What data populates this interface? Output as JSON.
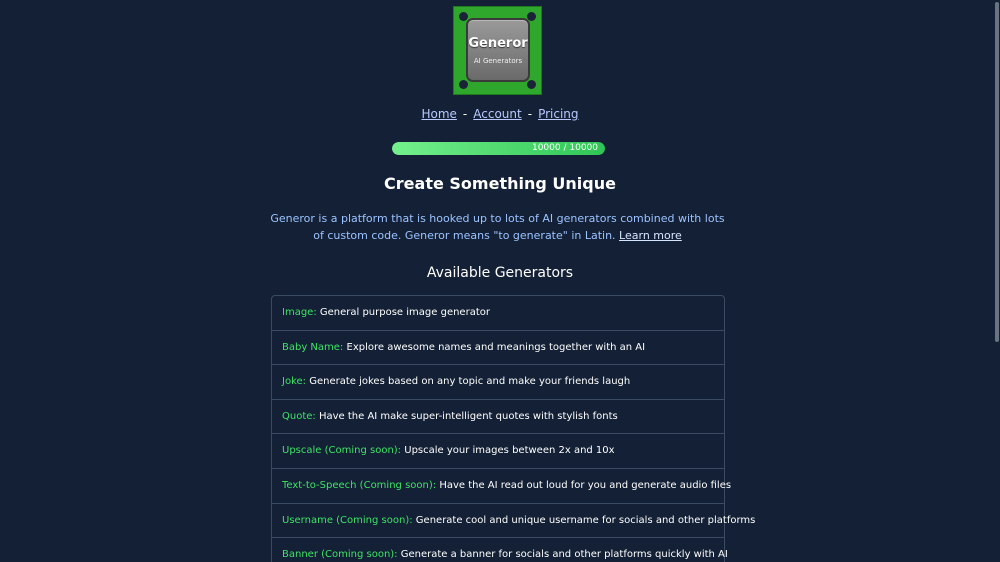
{
  "logo": {
    "title": "Generor",
    "subtitle": "AI Generators"
  },
  "nav": {
    "items": [
      {
        "label": "Home"
      },
      {
        "label": "Account"
      },
      {
        "label": "Pricing"
      }
    ],
    "separator": "-"
  },
  "credits": {
    "text": "10000 / 10000",
    "fraction": 1.0
  },
  "main": {
    "heading": "Create Something Unique",
    "intro": "Generor is a platform that is hooked up to lots of AI generators combined with lots of custom code. Generor means \"to generate\" in Latin.",
    "learn_more": "Learn more",
    "generators_heading": "Available Generators",
    "generators": [
      {
        "name": "Image:",
        "description": "General purpose image generator"
      },
      {
        "name": "Baby Name:",
        "description": "Explore awesome names and meanings together with an AI"
      },
      {
        "name": "Joke:",
        "description": "Generate jokes based on any topic and make your friends laugh"
      },
      {
        "name": "Quote:",
        "description": "Have the AI make super-intelligent quotes with stylish fonts"
      },
      {
        "name": "Upscale (Coming soon):",
        "description": "Upscale your images between 2x and 10x"
      },
      {
        "name": "Text-to-Speech (Coming soon):",
        "description": "Have the AI read out loud for you and generate audio files"
      },
      {
        "name": "Username (Coming soon):",
        "description": "Generate cool and unique username for socials and other platforms"
      },
      {
        "name": "Banner (Coming soon):",
        "description": "Generate a banner for socials and other platforms quickly with AI"
      }
    ]
  },
  "colors": {
    "background": "#132035",
    "accent_green": "#3ee364",
    "link_blue": "#b9c8ff",
    "intro_text": "#9cc3ff",
    "logo_green": "#2fa62c"
  }
}
